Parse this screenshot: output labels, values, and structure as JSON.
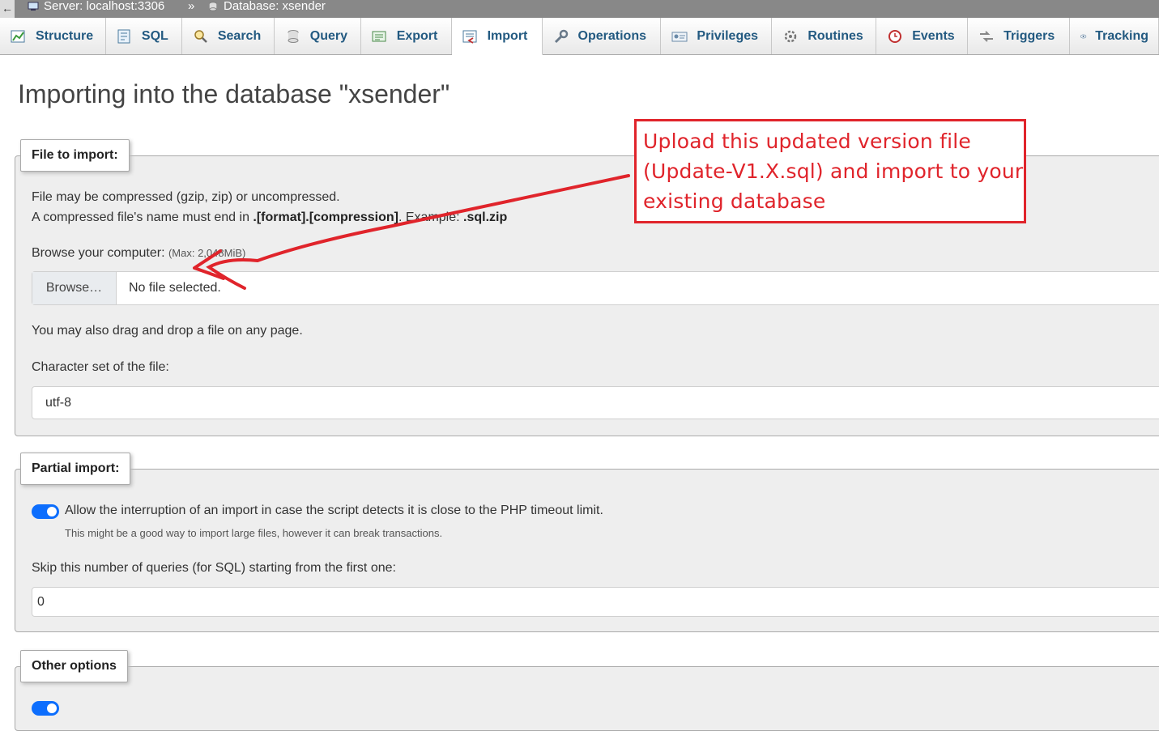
{
  "breadcrumb": {
    "back": "←",
    "server": "Server: localhost:3306",
    "separator": "»",
    "database": "Database: xsender"
  },
  "tabs": [
    {
      "label": "Structure",
      "icon": "structure-icon"
    },
    {
      "label": "SQL",
      "icon": "sql-icon"
    },
    {
      "label": "Search",
      "icon": "search-icon"
    },
    {
      "label": "Query",
      "icon": "query-icon"
    },
    {
      "label": "Export",
      "icon": "export-icon"
    },
    {
      "label": "Import",
      "icon": "import-icon",
      "active": true
    },
    {
      "label": "Operations",
      "icon": "wrench-icon"
    },
    {
      "label": "Privileges",
      "icon": "privileges-icon"
    },
    {
      "label": "Routines",
      "icon": "routines-icon"
    },
    {
      "label": "Events",
      "icon": "clock-icon"
    },
    {
      "label": "Triggers",
      "icon": "triggers-icon"
    },
    {
      "label": "Tracking",
      "icon": "eye-icon"
    }
  ],
  "page": {
    "title": "Importing into the database \"xsender\""
  },
  "file_import": {
    "legend": "File to import:",
    "line1": "File may be compressed (gzip, zip) or uncompressed.",
    "line2_prefix": "A compressed file's name must end in ",
    "line2_format": ".[format].[compression]",
    "line2_middle": ". Example: ",
    "line2_example": ".sql.zip",
    "browse_label": "Browse your computer:",
    "max_size": "(Max: 2,048MiB)",
    "browse_button": "Browse…",
    "no_file": "No file selected.",
    "drag_drop": "You may also drag and drop a file on any page.",
    "charset_label": "Character set of the file:",
    "charset_value": "utf-8"
  },
  "partial_import": {
    "legend": "Partial import:",
    "allow_interrupt": "Allow the interruption of an import in case the script detects it is close to the PHP timeout limit.",
    "allow_hint": "This might be a good way to import large files, however it can break transactions.",
    "skip_label": "Skip this number of queries (for SQL) starting from the first one:",
    "skip_value": "0"
  },
  "other_options": {
    "legend": "Other options"
  },
  "annotation": {
    "line1": "Upload this updated version file",
    "line2": "(Update-V1.X.sql) and import to your",
    "line3": "existing database",
    "color": "#e0242b"
  },
  "colors": {
    "tab_text": "#235a81",
    "toggle_on": "#0d6efd",
    "panel_bg": "#eeeeee"
  }
}
